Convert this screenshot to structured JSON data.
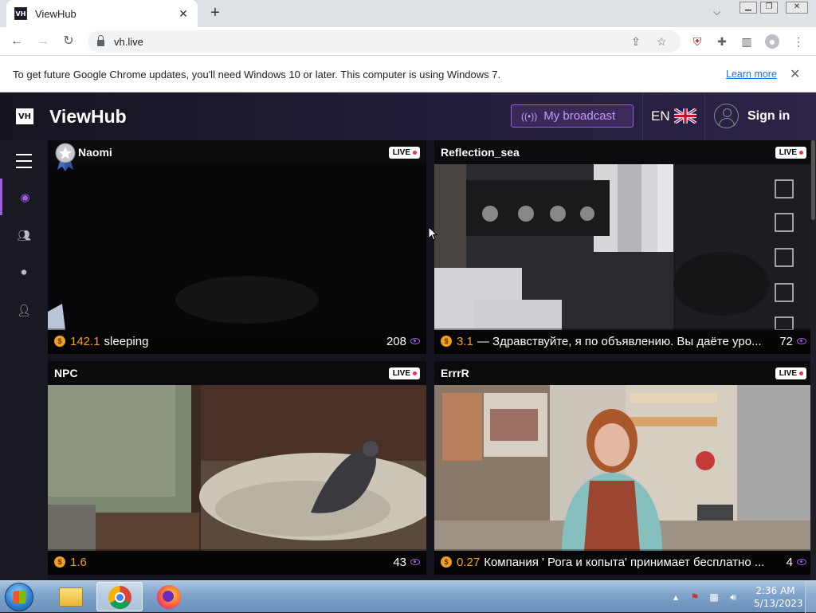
{
  "browser": {
    "tab_title": "ViewHub",
    "favicon_text": "VH",
    "url": "vh.live",
    "infobar": {
      "message": "To get future Google Chrome updates, you'll need Windows 10 or later. This computer is using Windows 7.",
      "link": "Learn more"
    },
    "extension_badge": "1"
  },
  "site": {
    "logo_mark": "VH",
    "logo_text": "ViewHub",
    "broadcast_label": "My broadcast",
    "language": "EN",
    "sign_in": "Sign in",
    "accent_color": "#9c5be0"
  },
  "streams": [
    {
      "name": "Naomi",
      "live": "LIVE",
      "coins": "142.1",
      "status": "sleeping",
      "viewers": "208",
      "badge": "star-badge"
    },
    {
      "name": "Reflection_sea",
      "live": "LIVE",
      "coins": "3.1",
      "status": "— Здравствуйте, я по объявлению. Вы даёте уро...",
      "viewers": "72"
    },
    {
      "name": "NPC",
      "live": "LIVE",
      "coins": "1.6",
      "status": "",
      "viewers": "43"
    },
    {
      "name": "ErrrR",
      "live": "LIVE",
      "coins": "0.27",
      "status": "Компания ' Рога и копыта' принимает бесплатно ...",
      "viewers": "4"
    }
  ],
  "taskbar": {
    "time": "2:36 AM",
    "date": "5/13/2023"
  }
}
